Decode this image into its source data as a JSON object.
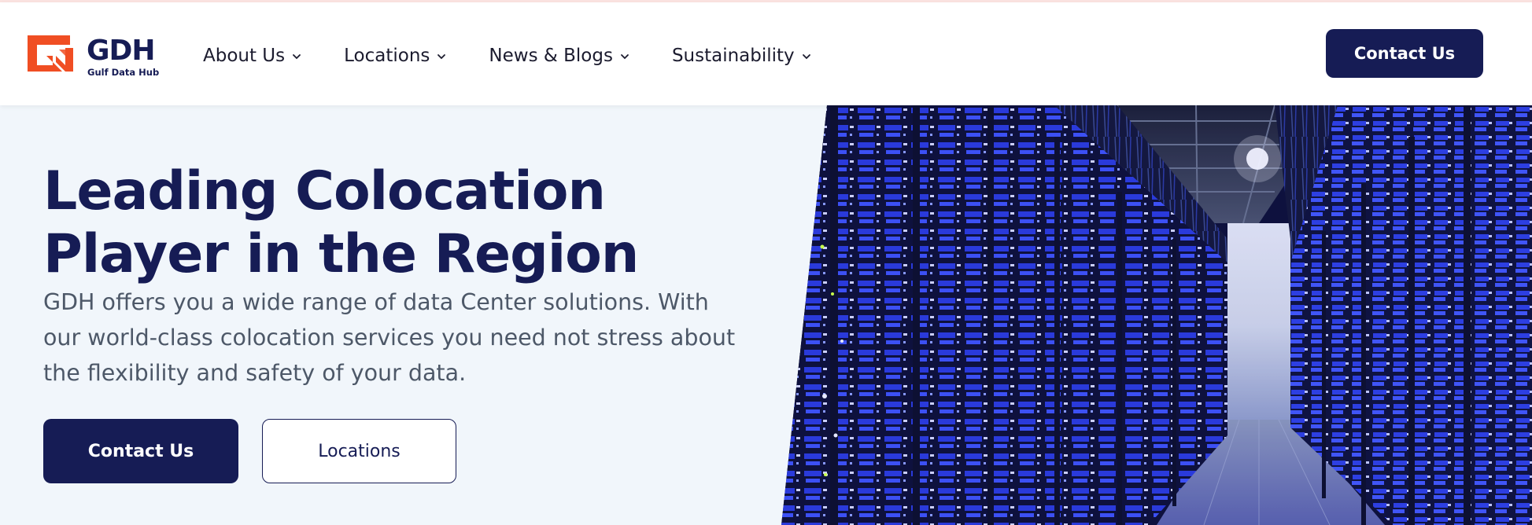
{
  "brand": {
    "name": "GDH",
    "tagline": "Gulf Data Hub",
    "primary_color": "#161c55",
    "accent_color": "#f04e23"
  },
  "nav": {
    "items": [
      {
        "label": "About Us",
        "icon": "chevron-down-icon"
      },
      {
        "label": "Locations",
        "icon": "chevron-down-icon"
      },
      {
        "label": "News & Blogs",
        "icon": "chevron-down-icon"
      },
      {
        "label": "Sustainability",
        "icon": "chevron-down-icon"
      }
    ],
    "cta_label": "Contact Us"
  },
  "hero": {
    "title_line1": "Leading Colocation",
    "title_line2": "Player in the Region",
    "description": "GDH offers you a wide range of data Center solutions. With our world-class colocation services you need not stress about the flexibility and safety of your data.",
    "primary_button": "Contact Us",
    "secondary_button": "Locations",
    "image": "data-center-server-aisle-image"
  }
}
